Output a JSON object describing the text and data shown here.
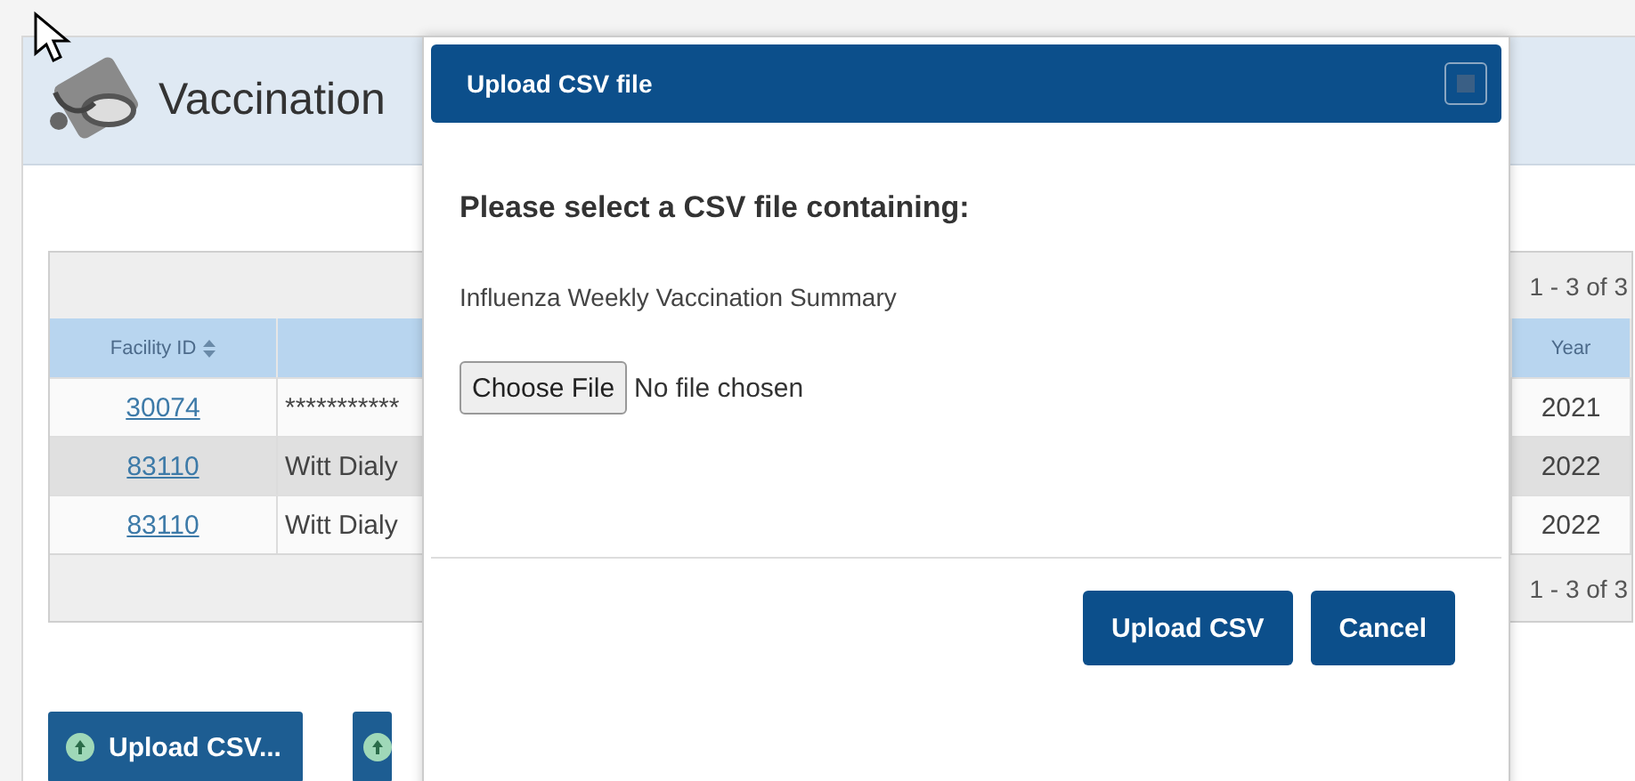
{
  "page": {
    "title": "Vaccination"
  },
  "table": {
    "range_top": "1 - 3 of 3",
    "range_bottom": "1 - 3 of 3",
    "columns": [
      {
        "label": "Facility ID",
        "sortable": true
      },
      {
        "label": "Year",
        "sortable": false
      }
    ],
    "rows": [
      {
        "facility_id": "30074",
        "column_2": "***********",
        "year": "2021",
        "striped": false
      },
      {
        "facility_id": "83110",
        "column_2": "Witt Dialy",
        "year": "2022",
        "striped": true
      },
      {
        "facility_id": "83110",
        "column_2": "Witt Dialy",
        "year": "2022",
        "striped": false
      }
    ]
  },
  "bottom_buttons": [
    {
      "kind": "labeled",
      "label": "Upload CSV..."
    },
    {
      "kind": "covered"
    }
  ],
  "dialog": {
    "title": "Upload CSV file",
    "heading": "Please select a CSV file containing:",
    "file_type": "Influenza Weekly Vaccination Summary",
    "file_input": {
      "button": "Choose File",
      "status": "No file chosen"
    },
    "buttons": [
      {
        "label": "Upload CSV"
      },
      {
        "label": "Cancel"
      }
    ]
  }
}
